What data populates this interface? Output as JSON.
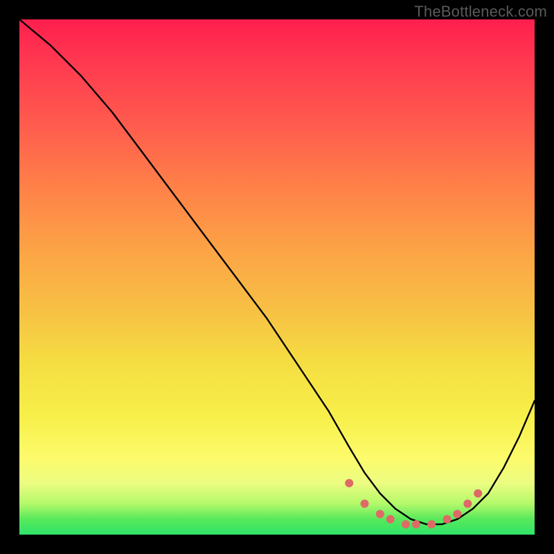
{
  "watermark": "TheBottleneck.com",
  "colors": {
    "background": "#000000",
    "curve": "#000000",
    "marker": "#de6a67",
    "gradient_top": "#ff1f4d",
    "gradient_bottom": "#2fe36a"
  },
  "chart_data": {
    "type": "line",
    "title": "",
    "xlabel": "",
    "ylabel": "",
    "xlim": [
      0,
      100
    ],
    "ylim": [
      0,
      100
    ],
    "grid": false,
    "legend": false,
    "series": [
      {
        "name": "bottleneck-curve",
        "x": [
          0,
          6,
          12,
          18,
          24,
          30,
          36,
          42,
          48,
          54,
          60,
          64,
          67,
          70,
          73,
          76,
          79,
          82,
          85,
          88,
          91,
          94,
          97,
          100
        ],
        "y": [
          100,
          95,
          89,
          82,
          74,
          66,
          58,
          50,
          42,
          33,
          24,
          17,
          12,
          8,
          5,
          3,
          2,
          2,
          3,
          5,
          8,
          13,
          19,
          26
        ]
      }
    ],
    "markers": {
      "name": "highlight-dots",
      "x": [
        64,
        67,
        70,
        72,
        75,
        77,
        80,
        83,
        85,
        87,
        89
      ],
      "y": [
        10,
        6,
        4,
        3,
        2,
        2,
        2,
        3,
        4,
        6,
        8
      ]
    }
  }
}
